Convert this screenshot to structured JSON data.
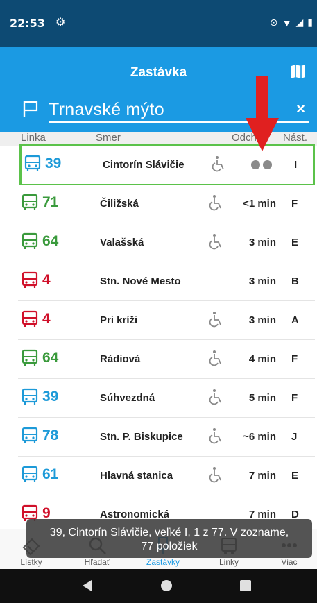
{
  "status": {
    "time": "22:53"
  },
  "header": {
    "title": "Zastávka",
    "stop_name": "Trnavské mýto",
    "close": "×"
  },
  "columns": {
    "line": "Linka",
    "direction": "Smer",
    "departure": "Odchod",
    "platform": "Nást."
  },
  "departures": [
    {
      "line": "39",
      "direction": "Cintorín Slávičie",
      "time": "",
      "platform": "I",
      "color": "#1d9ad8",
      "accessible": true
    },
    {
      "line": "71",
      "direction": "Čiližská",
      "time": "<1 min",
      "platform": "F",
      "color": "#3a9a3c",
      "accessible": true
    },
    {
      "line": "64",
      "direction": "Valašská",
      "time": "3 min",
      "platform": "E",
      "color": "#3a9a3c",
      "accessible": true
    },
    {
      "line": "4",
      "direction": "Stn. Nové Mesto",
      "time": "3 min",
      "platform": "B",
      "color": "#d0102a",
      "accessible": false
    },
    {
      "line": "4",
      "direction": "Pri kríži",
      "time": "3 min",
      "platform": "A",
      "color": "#d0102a",
      "accessible": true
    },
    {
      "line": "64",
      "direction": "Rádiová",
      "time": "4 min",
      "platform": "F",
      "color": "#3a9a3c",
      "accessible": true
    },
    {
      "line": "39",
      "direction": "Súhvezdná",
      "time": "5 min",
      "platform": "F",
      "color": "#1d9ad8",
      "accessible": true
    },
    {
      "line": "78",
      "direction": "Stn. P. Biskupice",
      "time": "~6 min",
      "platform": "J",
      "color": "#1d9ad8",
      "accessible": true
    },
    {
      "line": "61",
      "direction": "Hlavná stanica",
      "time": "7 min",
      "platform": "E",
      "color": "#1d9ad8",
      "accessible": true
    },
    {
      "line": "9",
      "direction": "Astronomická",
      "time": "7 min",
      "platform": "D",
      "color": "#d0102a",
      "accessible": false
    }
  ],
  "bottom_nav": [
    {
      "label": "Lístky",
      "icon": "tickets-icon"
    },
    {
      "label": "Hľadať",
      "icon": "search-icon"
    },
    {
      "label": "Zastávky",
      "icon": "stops-icon"
    },
    {
      "label": "Linky",
      "icon": "lines-icon"
    },
    {
      "label": "Viac",
      "icon": "more-icon"
    }
  ],
  "toast": {
    "line1": "39, Cintorín Slávičie, veľké I, 1 z 77. V zozname,",
    "line2": "77 položiek"
  },
  "colors": {
    "header": "#1b9ae3",
    "status": "#0d4a73",
    "highlight": "#5bc24a",
    "arrow": "#e02020"
  }
}
